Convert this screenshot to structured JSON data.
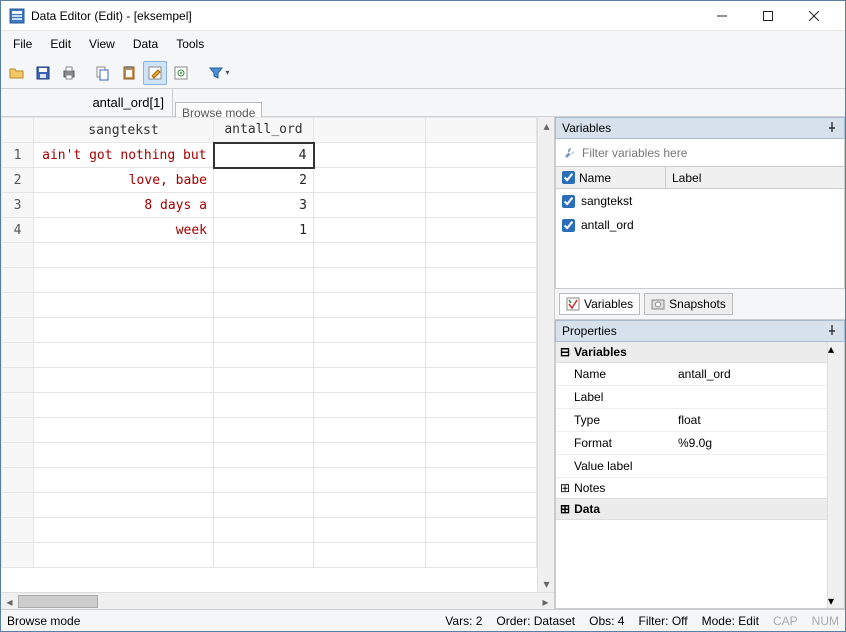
{
  "window": {
    "title": "Data Editor (Edit) - [eksempel]"
  },
  "menu": {
    "items": [
      "File",
      "Edit",
      "View",
      "Data",
      "Tools"
    ]
  },
  "formulabar": {
    "name": "antall_ord[1]",
    "badge": "Browse mode"
  },
  "columns": {
    "row": "",
    "c1": "sangtekst",
    "c2": "antall_ord"
  },
  "data_rows": [
    {
      "n": "1",
      "sangtekst": "ain't got nothing but",
      "antall_ord": "4"
    },
    {
      "n": "2",
      "sangtekst": "love, babe",
      "antall_ord": "2"
    },
    {
      "n": "3",
      "sangtekst": "8 days a",
      "antall_ord": "3"
    },
    {
      "n": "4",
      "sangtekst": "week",
      "antall_ord": "1"
    }
  ],
  "variables_panel": {
    "title": "Variables",
    "filter_placeholder": "Filter variables here",
    "hdr_name": "Name",
    "hdr_label": "Label",
    "rows": [
      {
        "name": "sangtekst"
      },
      {
        "name": "antall_ord"
      }
    ],
    "tab_vars": "Variables",
    "tab_snaps": "Snapshots"
  },
  "properties_panel": {
    "title": "Properties",
    "section_vars": "Variables",
    "rows": {
      "name_k": "Name",
      "name_v": "antall_ord",
      "label_k": "Label",
      "label_v": "",
      "type_k": "Type",
      "type_v": "float",
      "format_k": "Format",
      "format_v": "%9.0g",
      "vlabel_k": "Value label",
      "vlabel_v": ""
    },
    "section_notes": "Notes",
    "section_data": "Data"
  },
  "statusbar": {
    "mode_left": "Browse mode",
    "vars": "Vars: 2",
    "order": "Order: Dataset",
    "obs": "Obs: 4",
    "filter": "Filter: Off",
    "mode": "Mode: Edit",
    "cap": "CAP",
    "num": "NUM"
  }
}
